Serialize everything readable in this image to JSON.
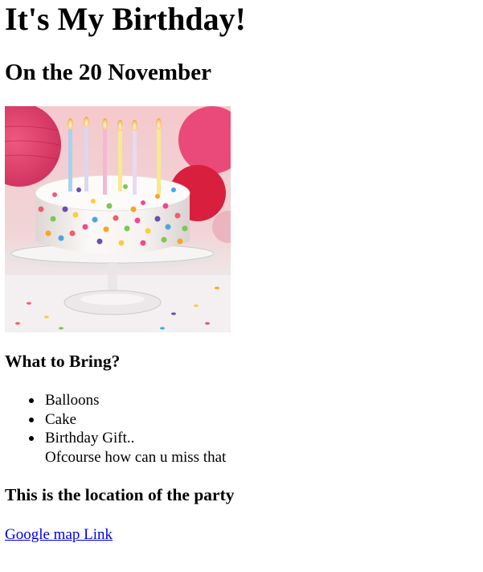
{
  "page": {
    "title": "It's My Birthday!",
    "date_line": "On the 20 November",
    "bring_heading": "What to Bring?",
    "bring_items": [
      {
        "label": "Balloons"
      },
      {
        "label": "Cake"
      },
      {
        "label": "Birthday Gift..",
        "note": "Ofcourse how can u miss that"
      }
    ],
    "location_heading": "This is the location of the party",
    "map_link_text": "Google map Link"
  },
  "colors": {
    "link": "#0000ee",
    "text": "#000000",
    "background": "#ffffff"
  }
}
